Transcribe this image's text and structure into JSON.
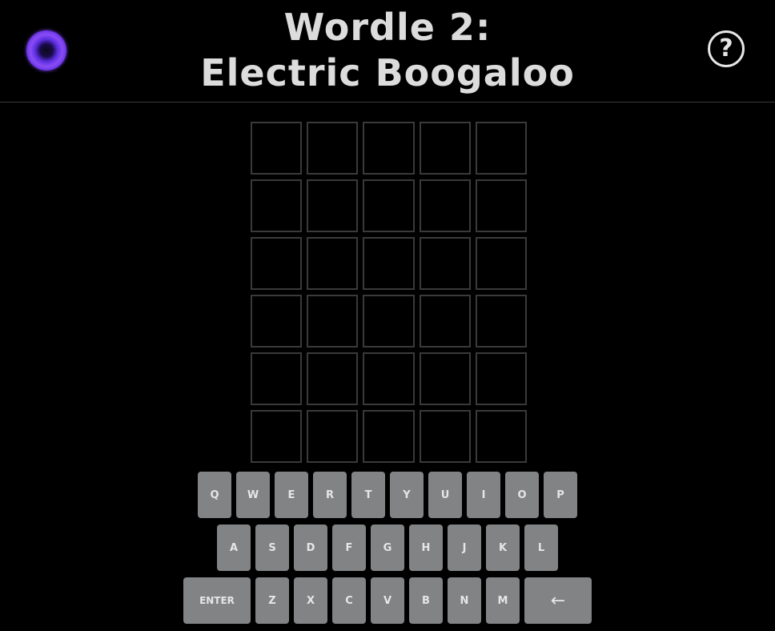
{
  "header": {
    "title_line1": "Wordle 2:",
    "title_line2": "Electric Boogaloo",
    "help_label": "?"
  },
  "board": {
    "rows": 6,
    "cols": 5,
    "letters": [
      [
        "",
        "",
        "",
        "",
        ""
      ],
      [
        "",
        "",
        "",
        "",
        ""
      ],
      [
        "",
        "",
        "",
        "",
        ""
      ],
      [
        "",
        "",
        "",
        "",
        ""
      ],
      [
        "",
        "",
        "",
        "",
        ""
      ],
      [
        "",
        "",
        "",
        "",
        ""
      ]
    ]
  },
  "keyboard": {
    "row1": [
      "Q",
      "W",
      "E",
      "R",
      "T",
      "Y",
      "U",
      "I",
      "O",
      "P"
    ],
    "row2": [
      "A",
      "S",
      "D",
      "F",
      "G",
      "H",
      "J",
      "K",
      "L"
    ],
    "row3": [
      "ENTER",
      "Z",
      "X",
      "C",
      "V",
      "B",
      "N",
      "M",
      "←"
    ]
  },
  "colors": {
    "background": "#000000",
    "tile_border": "#3a3a3c",
    "key_bg": "#818384",
    "text": "#e6e6e6",
    "orb_accent": "#8a4cf5"
  },
  "icons": {
    "theme_orb": "orb-icon",
    "help": "help-icon",
    "backspace": "backspace-icon"
  }
}
